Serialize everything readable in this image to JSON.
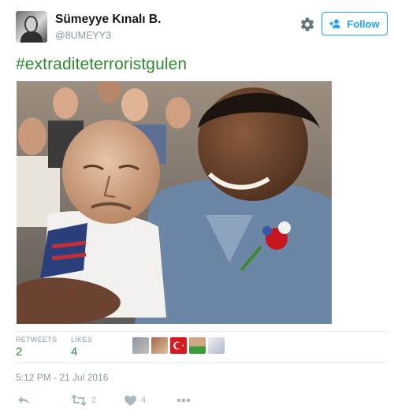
{
  "user": {
    "display_name": "Sümeyye Kınalı B.",
    "handle": "@8UMEYY3"
  },
  "header": {
    "settings_icon": "gear-icon",
    "follow_label": "Follow",
    "follow_icon": "add-user-icon"
  },
  "tweet": {
    "text": "#extraditeterroristgulen",
    "photo_alt_icon": "photo"
  },
  "stats": {
    "retweets_label": "RETWEETS",
    "retweets_value": "2",
    "likes_label": "LIKES",
    "likes_value": "4"
  },
  "timestamp": "5:12 PM - 21 Jul 2016",
  "actions": {
    "reply_icon": "reply-icon",
    "retweet_icon": "retweet-icon",
    "retweet_count": "2",
    "like_icon": "heart-icon",
    "like_count": "4",
    "more_icon": "more-icon"
  },
  "colors": {
    "hashtag_green": "#2d8a2d",
    "follow_blue": "#1da1f2",
    "muted": "#8899a6"
  }
}
